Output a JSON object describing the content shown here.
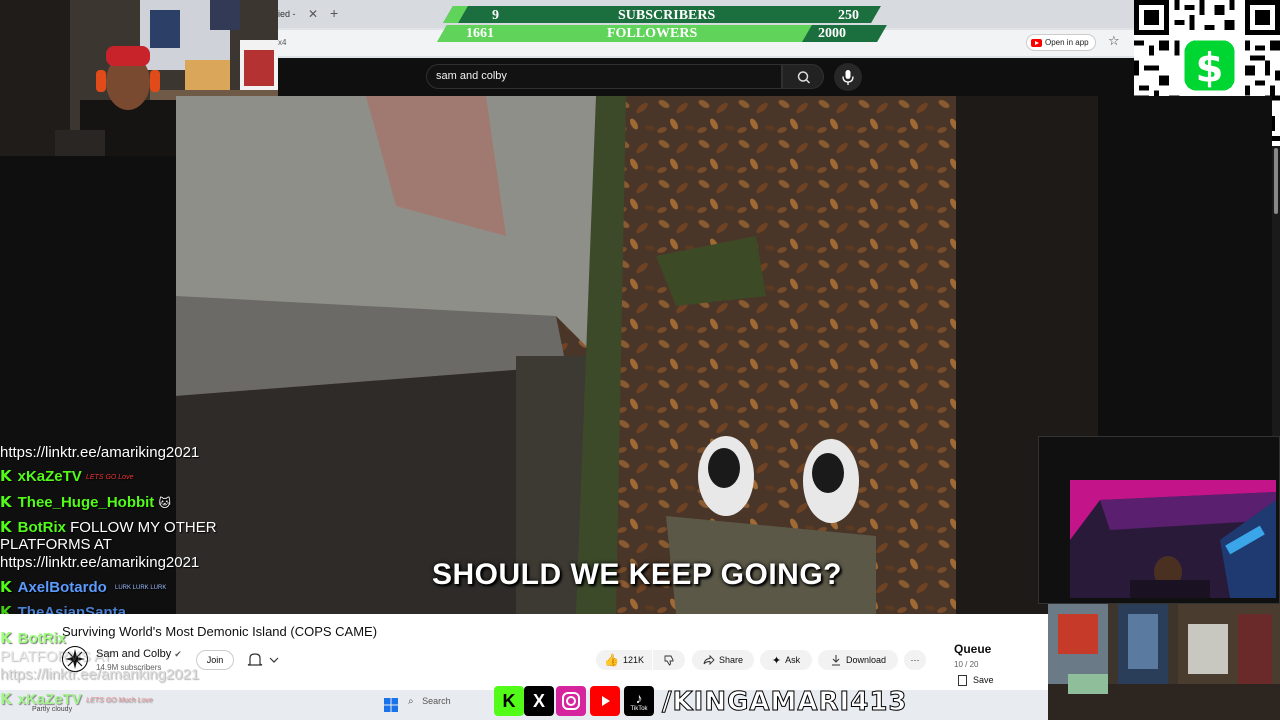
{
  "browser": {
    "tab_label": "ied -",
    "tab_close": "✕",
    "new_tab": "+",
    "address_tag": "x4",
    "open_in_app": "Open in app",
    "star": "☆"
  },
  "overlay": {
    "subscribers_count": "9",
    "subscribers_label": "SUBSCRIBERS",
    "subscribers_goal": "250",
    "subscribers_progress": 0.036,
    "followers_count": "1661",
    "followers_label": "FOLLOWERS",
    "followers_goal": "2000",
    "followers_progress": 0.83
  },
  "youtube": {
    "search_value": "sam and colby",
    "subtitle": "SHOULD WE KEEP GOING?",
    "video_title": "Surviving World's Most Demonic Island (COPS CAME)",
    "channel_name": "Sam and Colby",
    "channel_subs": "14.9M subscribers",
    "join_label": "Join",
    "likes": "121K",
    "share_label": "Share",
    "ask_label": "Ask",
    "download_label": "Download",
    "more_label": "···",
    "queue_title": "Queue",
    "queue_count": "10 / 20",
    "save_label": "Save"
  },
  "chat": [
    {
      "type": "text",
      "text": "https://linktr.ee/amariking2021"
    },
    {
      "user": "xKaZeTV",
      "user_color": "#53fc18",
      "badge": "LETS GO Love"
    },
    {
      "user": "Thee_Huge_Hobbit",
      "user_color": "#53fc18",
      "badge": "🐱"
    },
    {
      "user": "BotRix",
      "user_color": "#53fc18",
      "message": "FOLLOW MY OTHER"
    },
    {
      "type": "text",
      "text": "PLATFORMS AT"
    },
    {
      "type": "text",
      "text": "https://linktr.ee/amariking2021"
    },
    {
      "user": "AxelBotardo",
      "user_color": "#5b9bff",
      "badge": "LURK LURK LURK"
    },
    {
      "user": "TheAsianSanta",
      "user_color": "#5b9bff"
    },
    {
      "user": "BotRix",
      "user_color": "#53fc18"
    },
    {
      "type": "text",
      "text": "PLATFORMS AT"
    },
    {
      "type": "text",
      "text": "https://linktr.ee/amariking2021"
    },
    {
      "user": "xKaZeTV",
      "user_color": "#53fc18",
      "badge": "LETS GO Much Love"
    }
  ],
  "taskbar": {
    "search_label": "Search",
    "weather": "Partly cloudy"
  },
  "social": {
    "handle": "/KINGAMARI413",
    "icons": [
      "kick-icon",
      "x-icon",
      "instagram-icon",
      "youtube-icon",
      "tiktok-icon"
    ],
    "tiktok_label": "TikTok"
  },
  "colors": {
    "kick_green": "#53fc18",
    "overlay_bar": "#1b6f3e",
    "overlay_fill": "#5fd35a",
    "cashapp_green": "#00d632"
  }
}
